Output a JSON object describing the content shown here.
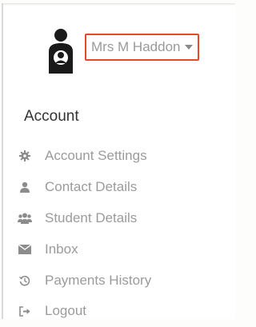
{
  "user": {
    "name": "Mrs M Haddon",
    "avatar_icon": "parent-child-icon"
  },
  "section": {
    "title": "Account"
  },
  "menu": {
    "items": [
      {
        "label": "Account Settings",
        "icon": "gear-icon"
      },
      {
        "label": "Contact Details",
        "icon": "user-icon"
      },
      {
        "label": "Student Details",
        "icon": "users-icon"
      },
      {
        "label": "Inbox",
        "icon": "envelope-icon"
      },
      {
        "label": "Payments History",
        "icon": "history-icon"
      },
      {
        "label": "Logout",
        "icon": "sign-out-icon"
      }
    ]
  },
  "colors": {
    "highlight_border": "#e24a2a",
    "menu_text": "#9b9b9b",
    "heading_text": "#333333"
  }
}
